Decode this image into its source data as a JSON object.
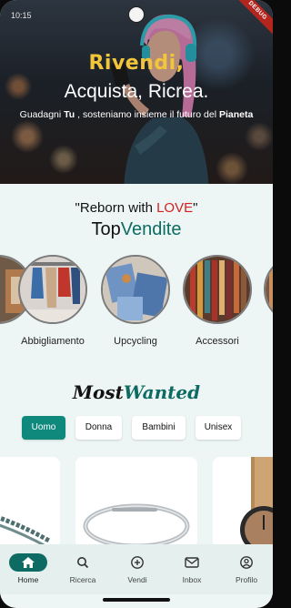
{
  "status": {
    "time": "10:15",
    "debug": "DEBUG"
  },
  "hero": {
    "brand": "Rivendi,",
    "title": "Acquista, Ricrea.",
    "subtitle_pre": "Guadagni ",
    "subtitle_bold1": "Tu",
    "subtitle_mid": " , sosteniamo insieme il futuro del ",
    "subtitle_bold2": "Pianeta"
  },
  "tagline": {
    "quote_open": "\"Reborn",
    "with": " with ",
    "love": "LOVE",
    "quote_close": "\""
  },
  "top_sellers": {
    "part1": "Top",
    "part2": "Vendite"
  },
  "categories": [
    {
      "label": "Abbigliamento"
    },
    {
      "label": "Upcycling"
    },
    {
      "label": "Accessori"
    }
  ],
  "most_wanted": {
    "part1": "Most",
    "part2": "Wanted"
  },
  "filters": [
    {
      "label": "Uomo",
      "active": true
    },
    {
      "label": "Donna",
      "active": false
    },
    {
      "label": "Bambini",
      "active": false
    },
    {
      "label": "Unisex",
      "active": false
    }
  ],
  "nav": [
    {
      "label": "Home",
      "icon": "home-icon",
      "active": true
    },
    {
      "label": "Ricerca",
      "icon": "search-icon",
      "active": false
    },
    {
      "label": "Vendi",
      "icon": "add-circle-icon",
      "active": false
    },
    {
      "label": "Inbox",
      "icon": "mail-icon",
      "active": false
    },
    {
      "label": "Profilo",
      "icon": "profile-icon",
      "active": false
    }
  ],
  "colors": {
    "accent": "#0d6b63",
    "chip_active": "#10897d",
    "brand_yellow": "#f2c53a",
    "love_red": "#d32020"
  }
}
